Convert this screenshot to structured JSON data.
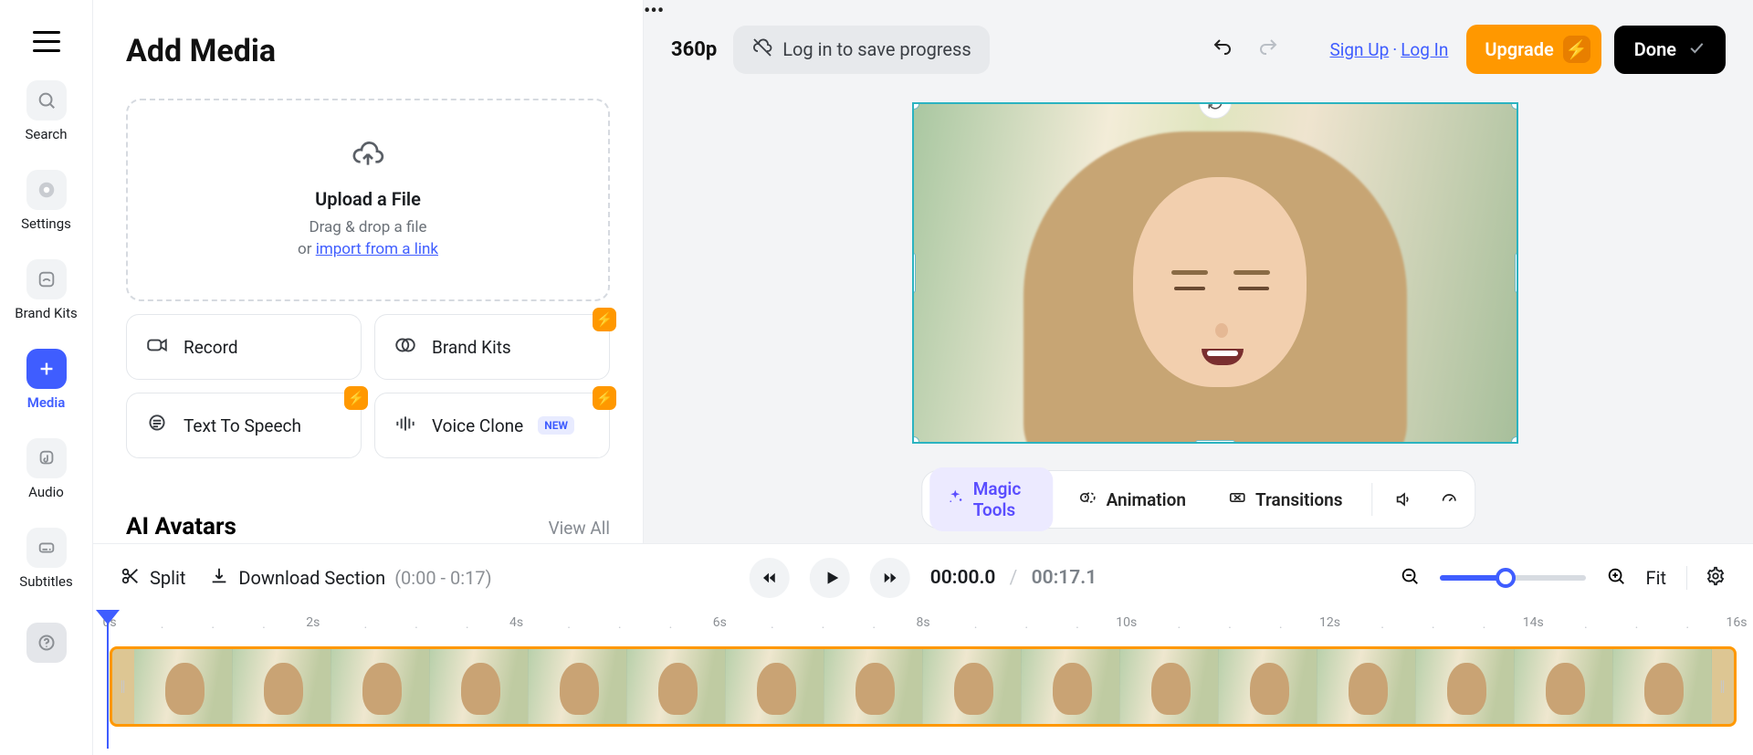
{
  "rail": {
    "items": [
      {
        "label": "Search"
      },
      {
        "label": "Settings"
      },
      {
        "label": "Brand Kits"
      },
      {
        "label": "Media"
      },
      {
        "label": "Audio"
      },
      {
        "label": "Subtitles"
      }
    ]
  },
  "panel": {
    "title": "Add Media",
    "upload": {
      "title": "Upload a File",
      "drag_label": "Drag & drop a file",
      "or_label": "or ",
      "link_label": "import from a link"
    },
    "cards": {
      "record": "Record",
      "brand_kits": "Brand Kits",
      "tts": "Text To Speech",
      "voice_clone": "Voice Clone",
      "new_badge": "NEW"
    },
    "avatars_heading": "AI Avatars",
    "view_all": "View All"
  },
  "topbar": {
    "resolution": "360p",
    "login_hint": "Log in to save progress",
    "sign_up": "Sign Up",
    "log_in": "Log In",
    "upgrade": "Upgrade",
    "done": "Done"
  },
  "tools": {
    "magic": "Magic Tools",
    "animation": "Animation",
    "transitions": "Transitions"
  },
  "timeline": {
    "split": "Split",
    "download_section": "Download Section",
    "download_range": "(0:00 - 0:17)",
    "current_time": "00:00.0",
    "duration": "00:17.1",
    "fit": "Fit",
    "ruler_labels": [
      "0s",
      "2s",
      "4s",
      "6s",
      "8s",
      "10s",
      "12s",
      "14s",
      "16s"
    ]
  }
}
